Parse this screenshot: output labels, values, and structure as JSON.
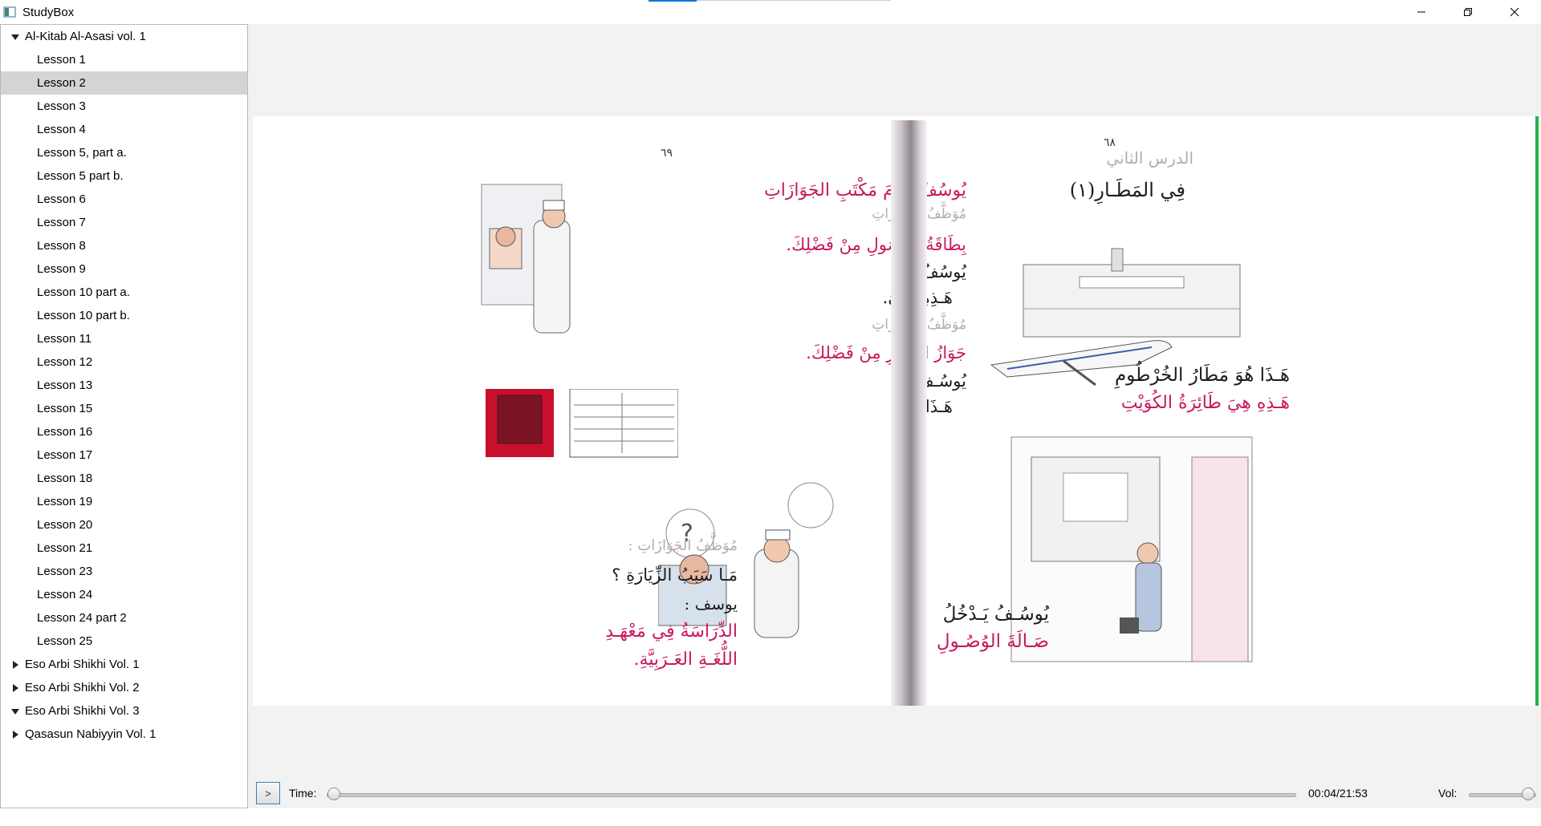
{
  "window": {
    "title": "StudyBox",
    "icon": "app-icon",
    "controls": [
      "minimize-icon",
      "maximize-icon",
      "close-icon"
    ]
  },
  "sidebar": {
    "books": [
      {
        "title": "Al-Kitab Al-Asasi vol. 1",
        "expanded": true,
        "lessons": [
          "Lesson 1",
          "Lesson 2",
          "Lesson 3",
          "Lesson 4",
          "Lesson 5, part a.",
          "Lesson 5 part b.",
          "Lesson 6",
          "Lesson 7",
          "Lesson 8",
          "Lesson 9",
          "Lesson 10 part a.",
          "Lesson 10 part b.",
          "Lesson 11",
          "Lesson 12",
          "Lesson 13",
          "Lesson 15",
          "Lesson 16",
          "Lesson 17",
          "Lesson 18",
          "Lesson 19",
          "Lesson 20",
          "Lesson 21",
          "Lesson 23",
          "Lesson 24",
          "Lesson 24 part 2",
          "Lesson 25"
        ],
        "selected_lesson": "Lesson 2"
      },
      {
        "title": "Eso Arbi Shikhi Vol. 1",
        "expanded": false
      },
      {
        "title": "Eso Arbi Shikhi Vol. 2",
        "expanded": false
      },
      {
        "title": "Eso Arbi Shikhi Vol. 3",
        "expanded": true
      },
      {
        "title": "Qasasun Nabiyyin Vol. 1",
        "expanded": false
      }
    ]
  },
  "viewer": {
    "left_page": {
      "page_number": "٦٩",
      "lines": [
        "يُوسُفُ أَمَامَ مَكْتَبِ الجَوَازَاتِ",
        "مُوَظَّفُ الجَوَازَاتِ",
        "بِطَاقَةُ الوُصُولِ مِنْ فَضْلِكَ.",
        "يُوسُفُ :",
        "هَـذِهِ هِـيَ.",
        "مُوَظَّفُ الجَوَازَاتِ",
        "جَوَازُ السَّفَرِ مِنْ فَضْلِكَ.",
        "يُوسُـفُ :",
        "هَـذَا هُـوَ.",
        "مُوَظَّفُ الجَوَازَاتِ :",
        "مَـا سَبَبُ الزِّيَارَةِ ؟",
        "يوسف :",
        "الدِّرَاسَةُ فِي مَعْهَـدِ",
        "اللُّغَـةِ العَـرَبِيَّةِ."
      ]
    },
    "right_page": {
      "page_number": "٦٨",
      "lesson_heading": "الدرس الثاني",
      "title": "فِي المَطَـارِ(١)",
      "lines": [
        "هَـذَا هُوَ مَطَارُ الخُرْطُومِ",
        "هَـذِهِ هِيَ طَائِرَةُ الكُوَيْتِ",
        "يُوسُـفُ يَـدْخُلُ",
        "صَـالَةَ الوُصُـولِ"
      ]
    },
    "accent_color": "#22b14c"
  },
  "player": {
    "play_label": ">",
    "time_label": "Time:",
    "time_readout": "00:04/21:53",
    "time_progress": 0.003,
    "volume_label": "Vol:",
    "volume_level": 1.0
  }
}
